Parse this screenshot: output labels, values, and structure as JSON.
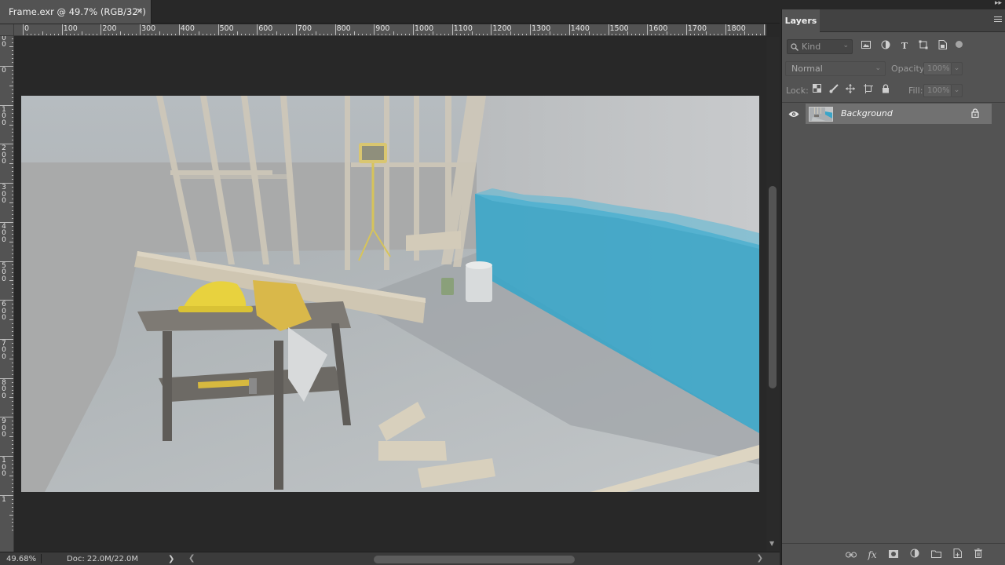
{
  "document": {
    "tab_title": "Frame.exr @ 49.7% (RGB/32*)",
    "close_glyph": "✕"
  },
  "ruler": {
    "top_labels": [
      "0",
      "100",
      "200",
      "300",
      "400",
      "500",
      "600",
      "700",
      "800",
      "900",
      "1000",
      "1100",
      "1200",
      "1300",
      "1400",
      "1500",
      "1600",
      "1700",
      "1800",
      "1"
    ],
    "left_labels": [
      "1\n0\n0",
      "0",
      "1\n0\n0",
      "2\n0\n0",
      "3\n0\n0",
      "4\n0\n0",
      "5\n0\n0",
      "6\n0\n0",
      "7\n0\n0",
      "8\n0\n0",
      "9\n0\n0",
      "1\n0\n0",
      "1"
    ]
  },
  "status": {
    "zoom": "49.68%",
    "doc": "Doc: 22.0M/22.0M",
    "arrow": "❯"
  },
  "layers_panel": {
    "tab": "Layers",
    "filter": {
      "placeholder": "Kind",
      "icons": [
        "image-filter-icon",
        "adjustment-filter-icon",
        "type-filter-icon",
        "shape-filter-icon",
        "smart-object-filter-icon"
      ]
    },
    "blend_mode": "Normal",
    "opacity_label": "Opacity:",
    "opacity_value": "100%",
    "lock_label": "Lock:",
    "fill_label": "Fill:",
    "fill_value": "100%",
    "layers": [
      {
        "name": "Background",
        "visible": true,
        "locked": true
      }
    ],
    "footer_icons": [
      "link-layers-icon",
      "fx-icon",
      "add-mask-icon",
      "adjustment-layer-icon",
      "new-group-icon",
      "new-layer-icon",
      "delete-layer-icon"
    ]
  },
  "colors": {
    "app_bg": "#282828",
    "panel_bg": "#535353",
    "selected_layer": "#717171",
    "wall_blue": "#3aa5c8"
  }
}
